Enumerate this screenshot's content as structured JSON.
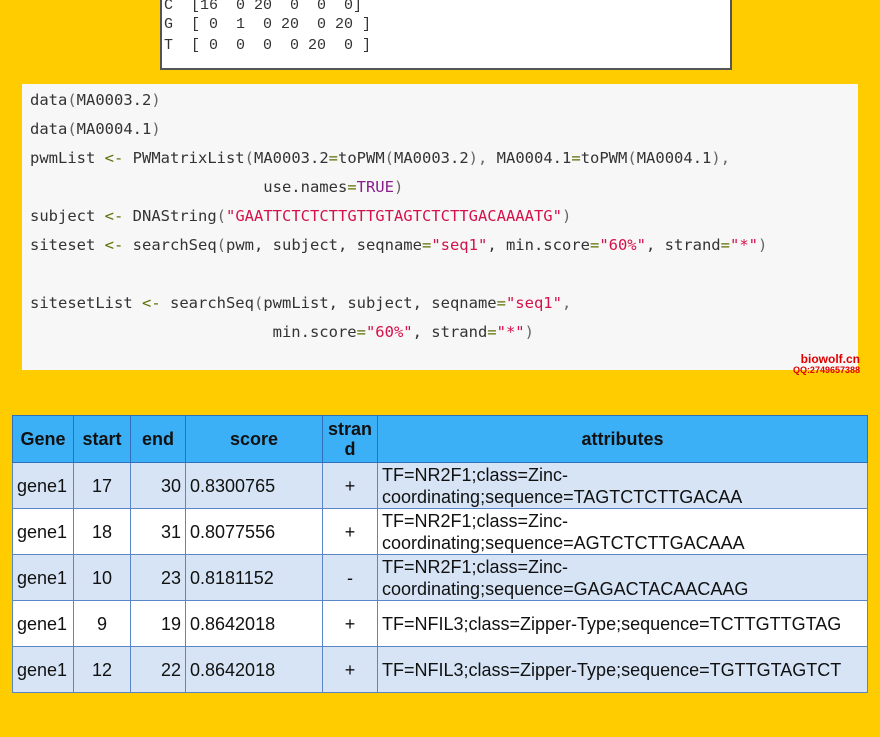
{
  "matrix": {
    "rows": [
      "C  [16  0 20  0  0  0]",
      "G  [ 0  1  0 20  0 20 ]",
      "T  [ 0  0  0  0 20  0 ]"
    ]
  },
  "code": {
    "lines": [
      [
        {
          "t": "data",
          "c": ""
        },
        {
          "t": "(",
          "c": "punc"
        },
        {
          "t": "MA0003.2",
          "c": ""
        },
        {
          "t": ")",
          "c": "punc"
        }
      ],
      [
        {
          "t": "data",
          "c": ""
        },
        {
          "t": "(",
          "c": "punc"
        },
        {
          "t": "MA0004.1",
          "c": ""
        },
        {
          "t": ")",
          "c": "punc"
        }
      ],
      [
        {
          "t": "pwmList ",
          "c": ""
        },
        {
          "t": "<-",
          "c": "op"
        },
        {
          "t": " PWMatrixList",
          "c": ""
        },
        {
          "t": "(",
          "c": "punc"
        },
        {
          "t": "MA0003.2",
          "c": ""
        },
        {
          "t": "=",
          "c": "op"
        },
        {
          "t": "toPWM",
          "c": ""
        },
        {
          "t": "(",
          "c": "punc"
        },
        {
          "t": "MA0003.2",
          "c": ""
        },
        {
          "t": "),",
          "c": "punc"
        },
        {
          "t": " MA0004.1",
          "c": ""
        },
        {
          "t": "=",
          "c": "op"
        },
        {
          "t": "toPWM",
          "c": ""
        },
        {
          "t": "(",
          "c": "punc"
        },
        {
          "t": "MA0004.1",
          "c": ""
        },
        {
          "t": "),",
          "c": "punc"
        }
      ],
      [
        {
          "t": "                         use.names",
          "c": ""
        },
        {
          "t": "=",
          "c": "op"
        },
        {
          "t": "TRUE",
          "c": "kw"
        },
        {
          "t": ")",
          "c": "punc"
        }
      ],
      [
        {
          "t": "subject ",
          "c": ""
        },
        {
          "t": "<-",
          "c": "op"
        },
        {
          "t": " DNAString",
          "c": ""
        },
        {
          "t": "(",
          "c": "punc"
        },
        {
          "t": "\"GAATTCTCTCTTGTTGTAGTCTCTTGACAAAATG\"",
          "c": "str"
        },
        {
          "t": ")",
          "c": "punc"
        }
      ],
      [
        {
          "t": "siteset ",
          "c": ""
        },
        {
          "t": "<-",
          "c": "op"
        },
        {
          "t": " searchSeq",
          "c": ""
        },
        {
          "t": "(",
          "c": "punc"
        },
        {
          "t": "pwm, subject, seqname",
          "c": ""
        },
        {
          "t": "=",
          "c": "op"
        },
        {
          "t": "\"seq1\"",
          "c": "str"
        },
        {
          "t": ", min.score",
          "c": ""
        },
        {
          "t": "=",
          "c": "op"
        },
        {
          "t": "\"60%\"",
          "c": "str"
        },
        {
          "t": ", strand",
          "c": ""
        },
        {
          "t": "=",
          "c": "op"
        },
        {
          "t": "\"*\"",
          "c": "str"
        },
        {
          "t": ")",
          "c": "punc"
        }
      ],
      [],
      [
        {
          "t": "sitesetList ",
          "c": ""
        },
        {
          "t": "<-",
          "c": "op"
        },
        {
          "t": " searchSeq",
          "c": ""
        },
        {
          "t": "(",
          "c": "punc"
        },
        {
          "t": "pwmList, subject, seqname",
          "c": ""
        },
        {
          "t": "=",
          "c": "op"
        },
        {
          "t": "\"seq1\"",
          "c": "str"
        },
        {
          "t": ",",
          "c": "punc"
        }
      ],
      [
        {
          "t": "                          min.score",
          "c": ""
        },
        {
          "t": "=",
          "c": "op"
        },
        {
          "t": "\"60%\"",
          "c": "str"
        },
        {
          "t": ", strand",
          "c": ""
        },
        {
          "t": "=",
          "c": "op"
        },
        {
          "t": "\"*\"",
          "c": "str"
        },
        {
          "t": ")",
          "c": "punc"
        }
      ]
    ]
  },
  "watermark": {
    "line1": "biowolf.cn",
    "line2": "QQ:2749657388"
  },
  "table": {
    "headers": [
      "Gene",
      "start",
      "end",
      "score",
      "strand",
      "attributes"
    ],
    "rows": [
      {
        "gene": "gene1",
        "start": "17",
        "end": "30",
        "score": "0.8300765",
        "strand": "+",
        "attr": "TF=NR2F1;class=Zinc-coordinating;sequence=TAGTCTCTTGACAA"
      },
      {
        "gene": "gene1",
        "start": "18",
        "end": "31",
        "score": "0.8077556",
        "strand": "+",
        "attr": "TF=NR2F1;class=Zinc-coordinating;sequence=AGTCTCTTGACAAA"
      },
      {
        "gene": "gene1",
        "start": "10",
        "end": "23",
        "score": "0.8181152",
        "strand": "-",
        "attr": "TF=NR2F1;class=Zinc-coordinating;sequence=GAGACTACAACAAG"
      },
      {
        "gene": "gene1",
        "start": "9",
        "end": "19",
        "score": "0.8642018",
        "strand": "+",
        "attr": "TF=NFIL3;class=Zipper-Type;sequence=TCTTGTTGTAG"
      },
      {
        "gene": "gene1",
        "start": "12",
        "end": "22",
        "score": "0.8642018",
        "strand": "+",
        "attr": "TF=NFIL3;class=Zipper-Type;sequence=TGTTGTAGTCT"
      }
    ]
  },
  "colors": {
    "background": "#FFCC00",
    "header": "#3BB0F7",
    "row_alt": "#D6E4F5",
    "string": "#D5114A",
    "keyword": "#8A1E8E",
    "operator": "#5E6D03",
    "watermark": "#E00000"
  }
}
